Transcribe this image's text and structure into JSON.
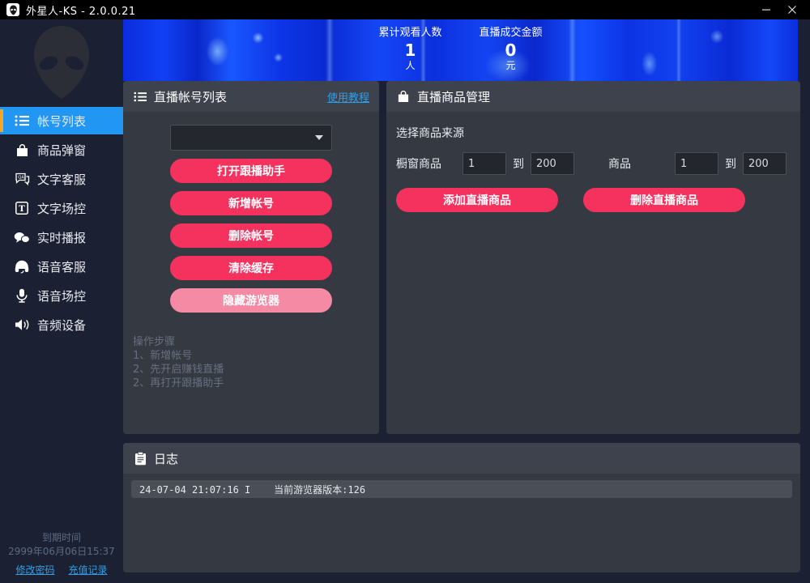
{
  "window": {
    "title": "外星人-KS - 2.0.0.21",
    "icon": "alien-icon",
    "minimize_label": "—",
    "close_label": "✕"
  },
  "sidebar": {
    "logo_icon": "alien-head-logo",
    "items": [
      {
        "icon": "list-icon",
        "label": "帐号列表",
        "active": true
      },
      {
        "icon": "bag-icon",
        "label": "商品弹窗",
        "active": false
      },
      {
        "icon": "qa-chat-icon",
        "label": "文字客服",
        "active": false
      },
      {
        "icon": "text-box-icon",
        "label": "文字场控",
        "active": false
      },
      {
        "icon": "bubbles-icon",
        "label": "实时播报",
        "active": false
      },
      {
        "icon": "headset-icon",
        "label": "语音客服",
        "active": false
      },
      {
        "icon": "mic-icon",
        "label": "语音场控",
        "active": false
      },
      {
        "icon": "speaker-icon",
        "label": "音频设备",
        "active": false
      }
    ],
    "expiry_label": "到期时间",
    "expiry_value": "2999年06月06日15:37",
    "links": [
      {
        "label": "修改密码"
      },
      {
        "label": "充值记录"
      }
    ]
  },
  "banner": {
    "stats": [
      {
        "label": "累计观看人数",
        "value": "1",
        "unit": "人"
      },
      {
        "label": "直播成交金额",
        "value": "0",
        "unit": "元"
      }
    ]
  },
  "accounts_panel": {
    "icon": "list-icon",
    "title": "直播帐号列表",
    "help_link": "使用教程",
    "account_select_value": "",
    "buttons": [
      {
        "label": "打开跟播助手",
        "style": "primary"
      },
      {
        "label": "新增帐号",
        "style": "primary"
      },
      {
        "label": "删除帐号",
        "style": "primary"
      },
      {
        "label": "清除缓存",
        "style": "primary"
      },
      {
        "label": "隐藏游览器",
        "style": "light"
      }
    ],
    "steps_title": "操作步骤",
    "steps": [
      "1、新增帐号",
      "2、先开启赚钱直播",
      "2、再打开跟播助手"
    ]
  },
  "goods_panel": {
    "icon": "bag-icon",
    "title": "直播商品管理",
    "source_label": "选择商品来源",
    "ranges": [
      {
        "label": "橱窗商品",
        "from": "1",
        "sep": "到",
        "to": "200"
      },
      {
        "label": "商品",
        "from": "1",
        "sep": "到",
        "to": "200"
      }
    ],
    "buttons": [
      {
        "label": "添加直播商品"
      },
      {
        "label": "删除直播商品"
      }
    ]
  },
  "log_panel": {
    "icon": "clipboard-icon",
    "title": "日志",
    "entries": [
      "24-07-04 21:07:16 I    当前游览器版本:126"
    ]
  },
  "colors": {
    "accent_pink": "#f5315e",
    "accent_pink_light": "#f58aa4",
    "nav_active_blue": "#2196f3",
    "nav_active_bar": "#f5a623",
    "link_blue": "#2f9fe8",
    "panel_bg": "#353942",
    "panel_head_bg": "#3e424d",
    "sidebar_bg": "#1b2133"
  }
}
